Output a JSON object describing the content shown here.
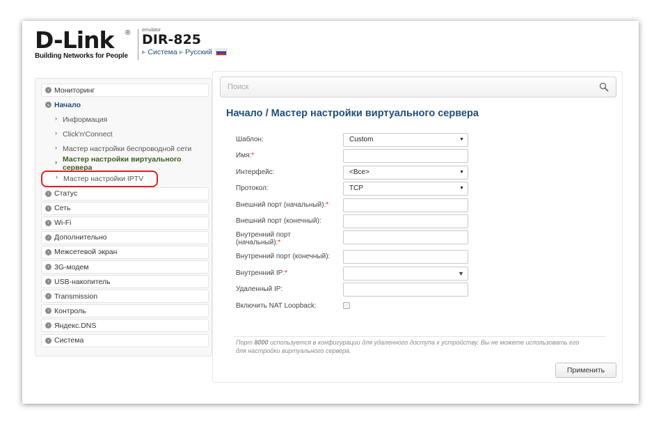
{
  "header": {
    "logo_text": "D-Link",
    "logo_reg": "®",
    "tagline": "Building Networks for People",
    "emulator_label": "emulator",
    "model": "DIR-825",
    "breadcrumbs": [
      "Система",
      "Русский"
    ]
  },
  "sidebar": {
    "items": [
      {
        "label": "Мониторинг"
      },
      {
        "label": "Начало"
      },
      {
        "label": "Информация"
      },
      {
        "label": "Click'n'Connect"
      },
      {
        "label": "Мастер настройки беспроводной сети"
      },
      {
        "label": "Мастер настройки виртуального сервера"
      },
      {
        "label": "Мастер настройки IPTV"
      },
      {
        "label": "Статус"
      },
      {
        "label": "Сеть"
      },
      {
        "label": "Wi-Fi"
      },
      {
        "label": "Дополнительно"
      },
      {
        "label": "Межсетевой экран"
      },
      {
        "label": "3G-модем"
      },
      {
        "label": "USB-накопитель"
      },
      {
        "label": "Transmission"
      },
      {
        "label": "Контроль"
      },
      {
        "label": "Яндекс.DNS"
      },
      {
        "label": "Система"
      }
    ]
  },
  "search": {
    "placeholder": "Поиск"
  },
  "page": {
    "title": "Начало /  Мастер настройки виртуального сервера"
  },
  "form": {
    "template_label": "Шаблон:",
    "template_value": "Custom",
    "name_label": "Имя:",
    "name_value": "",
    "interface_label": "Интерфейс:",
    "interface_value": "<Все>",
    "protocol_label": "Протокол:",
    "protocol_value": "TCP",
    "ext_port_start_label": "Внешний порт (начальный):",
    "ext_port_end_label": "Внешний порт (конечный):",
    "int_port_start_label_1": "Внутренний порт",
    "int_port_start_label_2": "(начальный):",
    "int_port_end_label": "Внутренний порт (конечный):",
    "int_ip_label": "Внутренний IP:",
    "remote_ip_label": "Удаленный IP:",
    "nat_loopback_label": "Включить NAT Loopback:",
    "required_mark": "*"
  },
  "note": {
    "part1": "Порт ",
    "port": "8000",
    "part2": " используется в конфигурации для удаленного доступа к устройству. Вы не можете использовать его для настройки виртуального сервера."
  },
  "apply_label": "Применить"
}
